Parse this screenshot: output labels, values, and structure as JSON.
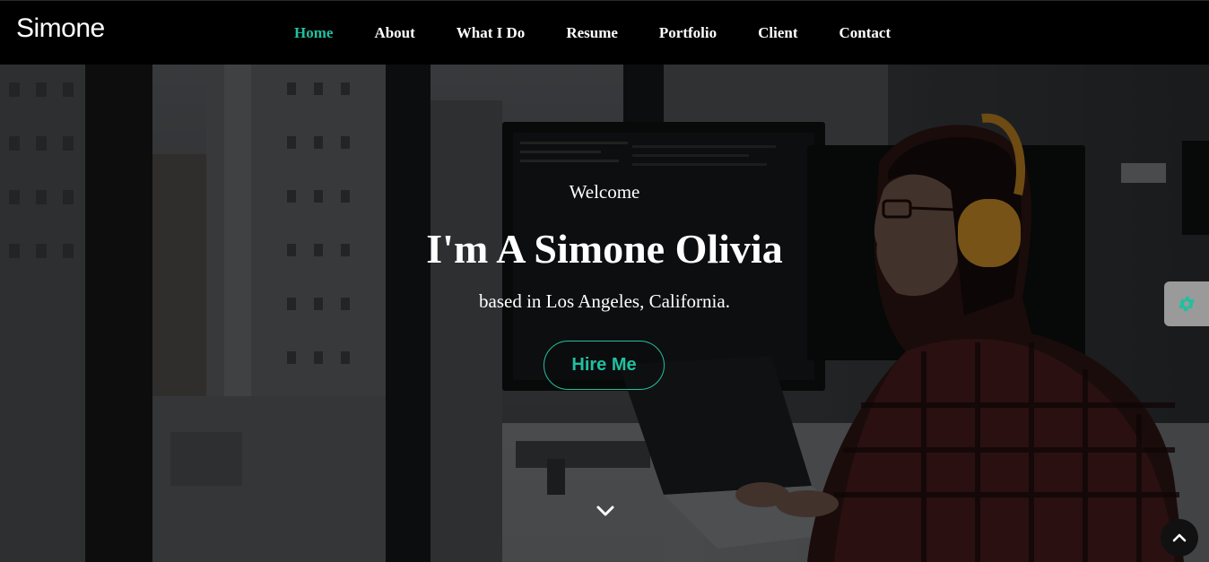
{
  "brand": {
    "name": "Simone"
  },
  "nav": {
    "items": [
      {
        "label": "Home",
        "active": true
      },
      {
        "label": "About"
      },
      {
        "label": "What I Do"
      },
      {
        "label": "Resume"
      },
      {
        "label": "Portfolio"
      },
      {
        "label": "Client"
      },
      {
        "label": "Contact"
      }
    ]
  },
  "hero": {
    "welcome": "Welcome",
    "headline": "I'm A Simone Olivia",
    "subline": "based in Los Angeles, California.",
    "cta_label": "Hire Me"
  },
  "icons": {
    "scroll_down": "chevron-down-icon",
    "settings": "gear-icon",
    "back_to_top": "chevron-up-icon"
  },
  "colors": {
    "accent": "#20c0a0",
    "navbar_bg": "#000000",
    "settings_tab": "#9a9a9a"
  }
}
